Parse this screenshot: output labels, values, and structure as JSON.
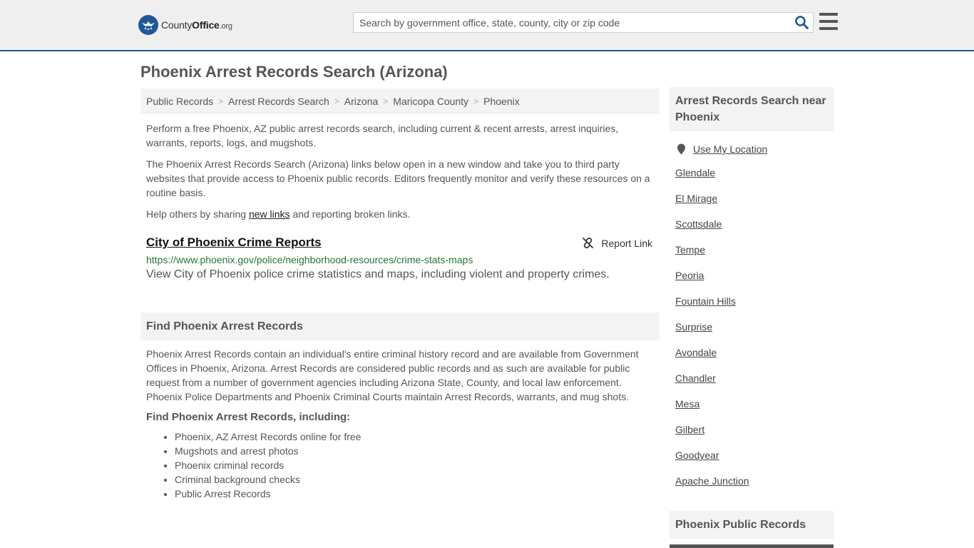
{
  "header": {
    "logo": {
      "part1": "County",
      "part2": "Office",
      "part3": ".org"
    },
    "search_placeholder": "Search by government office, state, county, city or zip code",
    "icons": {
      "search": "search-icon",
      "menu": "hamburger-menu-icon",
      "logo": "eagle-badge-icon"
    }
  },
  "page_title": "Phoenix Arrest Records Search (Arizona)",
  "breadcrumb": [
    {
      "label": "Public Records"
    },
    {
      "label": "Arrest Records Search"
    },
    {
      "label": "Arizona"
    },
    {
      "label": "Maricopa County"
    },
    {
      "label": "Phoenix"
    }
  ],
  "intro": {
    "p1": "Perform a free Phoenix, AZ public arrest records search, including current & recent arrests, arrest inquiries, warrants, reports, logs, and mugshots.",
    "p2": "The Phoenix Arrest Records Search (Arizona) links below open in a new window and take you to third party websites that provide access to Phoenix public records. Editors frequently monitor and verify these resources on a routine basis.",
    "p3_before": "Help others by sharing ",
    "p3_link": "new links",
    "p3_after": " and reporting broken links."
  },
  "link_card": {
    "title": "City of Phoenix Crime Reports",
    "report_label": "Report Link",
    "url": "https://www.phoenix.gov/police/neighborhood-resources/crime-stats-maps",
    "description": "View City of Phoenix police crime statistics and maps, including violent and property crimes."
  },
  "find_section": {
    "heading": "Find Phoenix Arrest Records",
    "paragraph": "Phoenix Arrest Records contain an individual's entire criminal history record and are available from Government Offices in Phoenix, Arizona. Arrest Records are considered public records and as such are available for public request from a number of government agencies including Arizona State, County, and local law enforcement. Phoenix Police Departments and Phoenix Criminal Courts maintain Arrest Records, warrants, and mug shots.",
    "subheading": "Find Phoenix Arrest Records, including:",
    "bullets": [
      "Phoenix, AZ Arrest Records online for free",
      "Mugshots and arrest photos",
      "Phoenix criminal records",
      "Criminal background checks",
      "Public Arrest Records"
    ]
  },
  "sidebar": {
    "heading": "Arrest Records Search near Phoenix",
    "use_location": "Use My Location",
    "cities": [
      "Glendale",
      "El Mirage",
      "Scottsdale",
      "Tempe",
      "Peoria",
      "Fountain Hills",
      "Surprise",
      "Avondale",
      "Chandler",
      "Mesa",
      "Gilbert",
      "Goodyear",
      "Apache Junction"
    ],
    "heading2": "Phoenix Public Records"
  },
  "colors": {
    "accent": "#1f5899",
    "url_green": "#23772e",
    "panel": "#f3f3f3"
  }
}
